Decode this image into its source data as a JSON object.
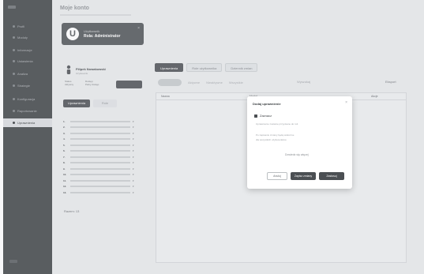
{
  "sidebar": {
    "items": [
      {
        "label": "Profil",
        "active": false
      },
      {
        "label": "Moduły",
        "active": false
      },
      {
        "label": "Informacje",
        "active": false
      },
      {
        "label": "Ustawienia",
        "active": false
      },
      {
        "label": "Analiza",
        "active": false
      },
      {
        "label": "Strategie",
        "active": false
      },
      {
        "label": "Konfiguracja",
        "active": false
      },
      {
        "label": "Raportowanie",
        "active": false
      },
      {
        "label": "Uprawnienia",
        "active": true
      }
    ]
  },
  "header": {
    "title": "Moje konto"
  },
  "user_card": {
    "avatar_letter": "U",
    "name": "Użytkownik",
    "role": "Rola: Administrator",
    "close": "×"
  },
  "detail": {
    "name": "Filipek Nowakowski",
    "sub": "Użytkownik",
    "kv": [
      {
        "k": "Status",
        "v": "Aktywny"
      },
      {
        "k": "Dostęp",
        "v": "Pełny dostęp"
      }
    ]
  },
  "segments": {
    "primary": "Uprawnienia",
    "secondary": "Role"
  },
  "list": {
    "rows": [
      "1.",
      "2.",
      "3.",
      "4.",
      "5.",
      "6.",
      "7.",
      "8.",
      "9.",
      "10.",
      "11.",
      "12.",
      "13."
    ],
    "footer": "Razem: 13"
  },
  "tabs": [
    {
      "label": "Uprawnienia",
      "active": true
    },
    {
      "label": "Role użytkownika",
      "active": false
    },
    {
      "label": "Dziennik zmian",
      "active": false
    }
  ],
  "filters": {
    "labels": [
      "Aktywne",
      "Nieaktywne",
      "Wszystkie"
    ],
    "search": "Wyszukaj",
    "end": "Eksport"
  },
  "table": {
    "col_a": "Nazwa",
    "col_b": "Moduł",
    "col_c": "Akcje"
  },
  "modal": {
    "title": "Dodaj uprawnienie",
    "close": "×",
    "check_label": "Zaznacz",
    "lines": [
      "Uprawnienie zostanie przypisane do roli.",
      "Po zapisaniu zmiany będą widoczne",
      "dla wszystkich użytkowników."
    ],
    "link": "Dowiedz się więcej",
    "cancel": "Anuluj",
    "confirm": "Zapisz zmiany",
    "apply": "Zastosuj"
  }
}
